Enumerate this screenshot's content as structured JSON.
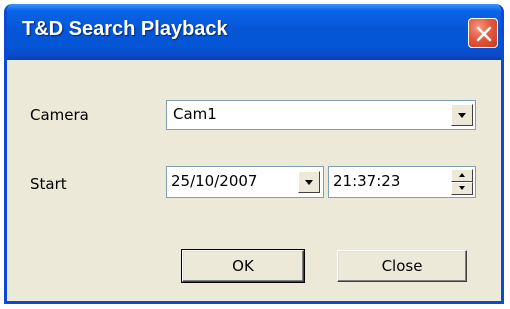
{
  "window": {
    "title": "T&D Search Playback"
  },
  "form": {
    "camera_label": "Camera",
    "camera_value": "Cam1",
    "start_label": "Start",
    "start_date": "25/10/2007",
    "start_time": "21:37:23"
  },
  "buttons": {
    "ok_label": "OK",
    "close_label": "Close"
  },
  "icons": {
    "close": "close-x-icon",
    "dropdown": "chevron-down-icon",
    "spin_up": "spin-up-arrow-icon",
    "spin_down": "spin-down-arrow-icon"
  },
  "colors": {
    "titlebar": "#0556d6",
    "window_bg": "#ece9d8",
    "close_button": "#e4593c"
  }
}
